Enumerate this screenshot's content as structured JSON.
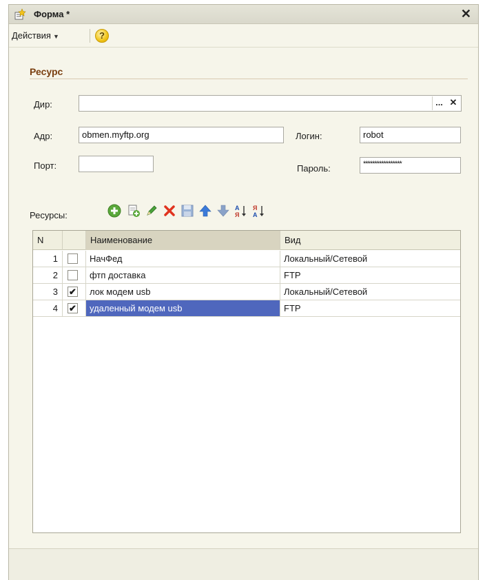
{
  "window": {
    "title": "Форма *"
  },
  "menu": {
    "actions_label": "Действия",
    "help_label": "?"
  },
  "section": {
    "title": "Ресурс"
  },
  "fields": {
    "dir": {
      "label": "Дир:",
      "value": "",
      "dots": "...",
      "clear": "✕"
    },
    "addr": {
      "label": "Адр:",
      "value": "obmen.myftp.org"
    },
    "login": {
      "label": "Логин:",
      "value": "robot"
    },
    "port": {
      "label": "Порт:",
      "value": ""
    },
    "password": {
      "label": "Пароль:",
      "value": "*****************"
    }
  },
  "resources": {
    "label": "Ресурсы:",
    "toolbar": [
      "add-icon",
      "copy-icon",
      "edit-icon",
      "delete-icon",
      "save-icon",
      "move-up-icon",
      "move-down-icon",
      "sort-asc-icon",
      "sort-desc-icon"
    ]
  },
  "table": {
    "columns": [
      "N",
      "",
      "Наименование",
      "Вид"
    ],
    "rows": [
      {
        "n": "1",
        "checked": false,
        "name": "НачФед",
        "kind": "Локальный/Сетевой"
      },
      {
        "n": "2",
        "checked": false,
        "name": "фтп доставка",
        "kind": "FTP"
      },
      {
        "n": "3",
        "checked": true,
        "name": "лок модем usb",
        "kind": "Локальный/Сетевой"
      },
      {
        "n": "4",
        "checked": true,
        "name": "удаленный модем usb",
        "kind": "FTP"
      }
    ],
    "selected_row": 4
  },
  "colors": {
    "selection": "#4f67bd",
    "section_title": "#7a3f10",
    "window_bg": "#f6f5ea"
  }
}
